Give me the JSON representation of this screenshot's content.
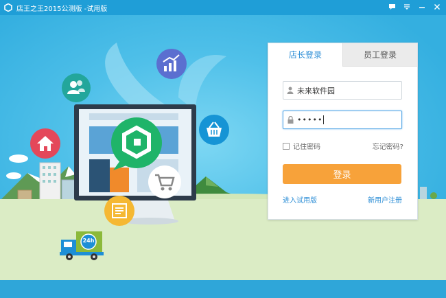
{
  "window": {
    "title": "店王之王2015公测版 -试用版"
  },
  "title_bar_controls": [
    {
      "name": "chat-icon",
      "glyph": "💬"
    },
    {
      "name": "dropdown-icon",
      "glyph": "▾"
    },
    {
      "name": "minimize-icon",
      "glyph": "−"
    },
    {
      "name": "close-icon",
      "glyph": "✕"
    }
  ],
  "illustration": {
    "badge_24h": "24h"
  },
  "login": {
    "tabs": [
      "店长登录",
      "员工登录"
    ],
    "active_tab": 0,
    "username": "未来软件园",
    "password_mask": "•••••",
    "remember_label": "记住密码",
    "forgot_label": "忘记密码?",
    "submit_label": "登录",
    "trial_link": "进入试用版",
    "register_link": "新用户注册"
  },
  "colors": {
    "accent_blue": "#2c8ed6",
    "login_button": "#f7a23a",
    "title_bar": "#1f9ed7"
  }
}
